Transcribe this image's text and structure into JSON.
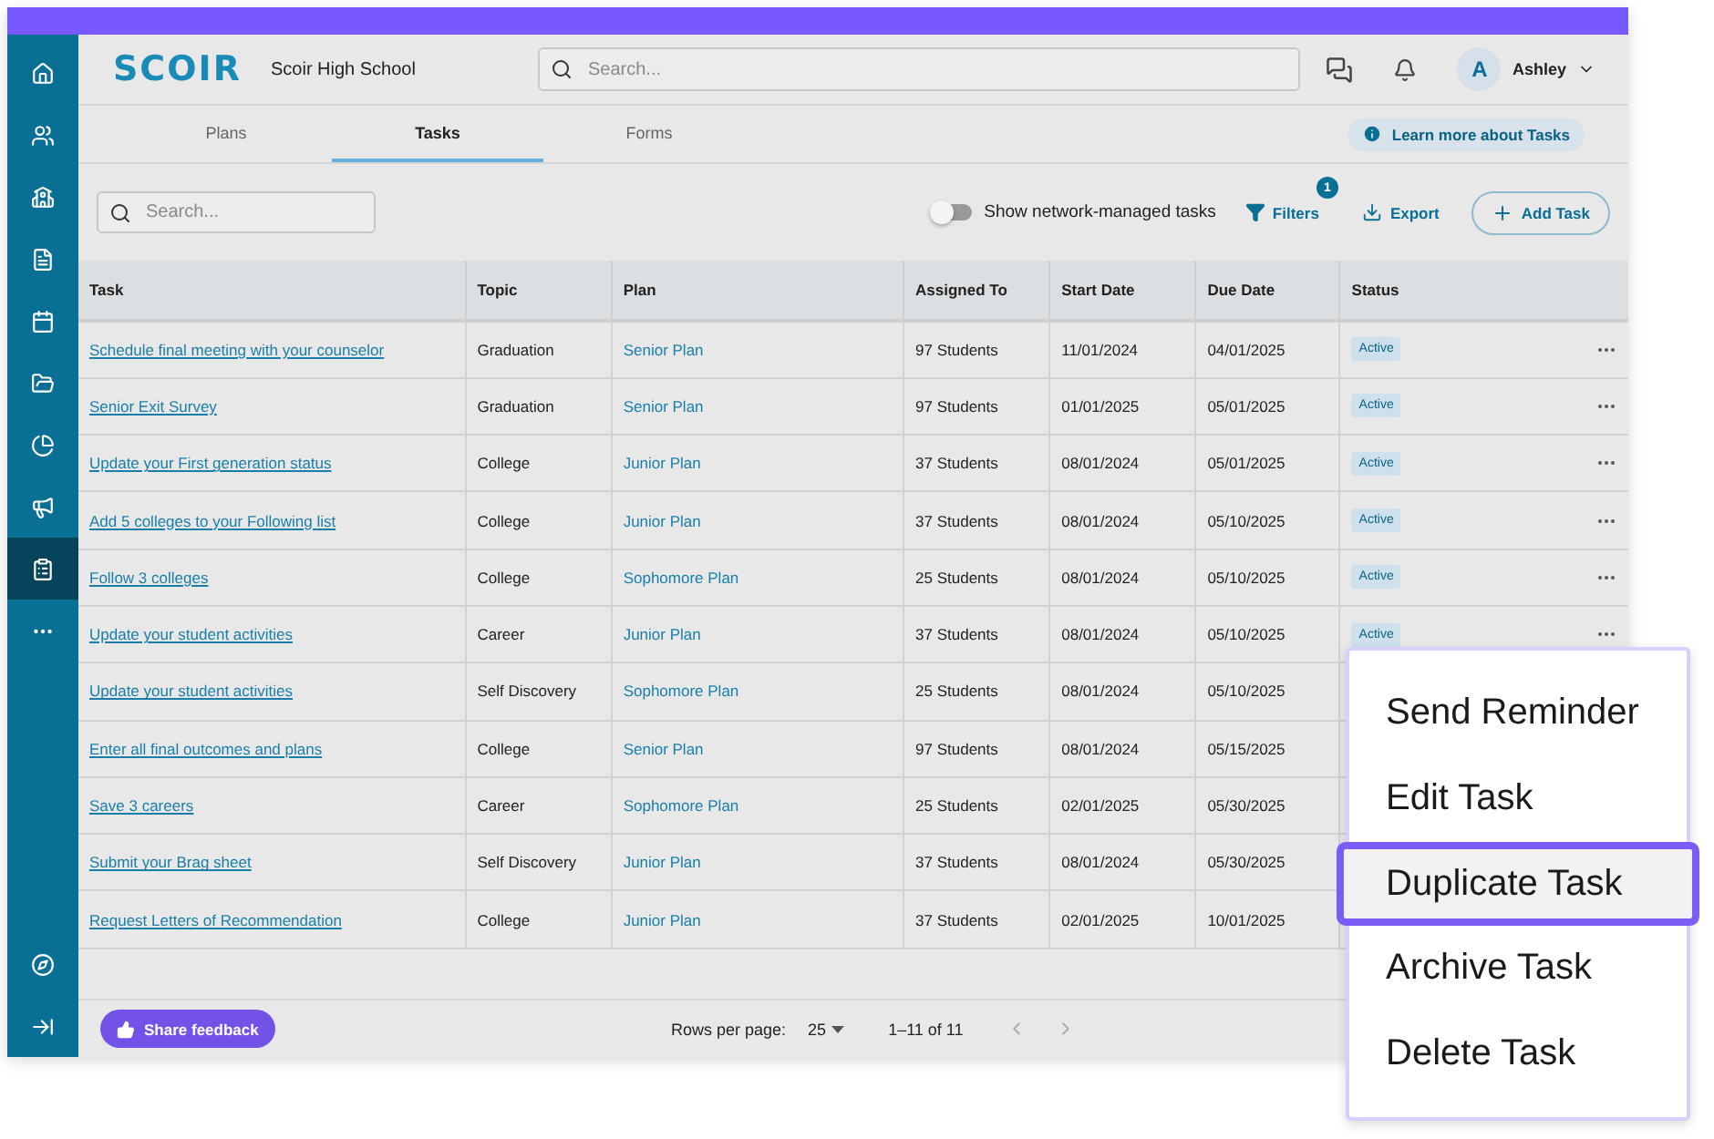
{
  "sidebar": {
    "items": [
      {
        "selected": false
      },
      {
        "selected": false
      },
      {
        "selected": false
      },
      {
        "selected": false
      },
      {
        "selected": false
      },
      {
        "selected": false
      },
      {
        "selected": false
      },
      {
        "selected": false
      },
      {
        "selected": true
      },
      {
        "selected": false
      }
    ]
  },
  "header": {
    "logo": "SCOIR",
    "school": "Scoir High School",
    "search": {
      "placeholder": "Search..."
    },
    "user": {
      "initial": "A",
      "name": "Ashley"
    }
  },
  "tabs": [
    {
      "label": "Plans",
      "selected": false
    },
    {
      "label": "Tasks",
      "selected": true
    },
    {
      "label": "Forms",
      "selected": false
    }
  ],
  "learn_more": "Learn more about Tasks",
  "toolbar": {
    "search": {
      "placeholder": "Search..."
    },
    "toggle": {
      "label": "Show network-managed tasks",
      "on": false
    },
    "filters": {
      "label": "Filters",
      "badge": "1"
    },
    "export": "Export",
    "add": "Add Task"
  },
  "table": {
    "columns": [
      "Task",
      "Topic",
      "Plan",
      "Assigned To",
      "Start Date",
      "Due Date",
      "Status"
    ],
    "rows": [
      {
        "task": "Schedule final meeting with your counselor",
        "topic": "Graduation",
        "plan": "Senior Plan",
        "assigned": "97 Students",
        "start": "11/01/2024",
        "due": "04/01/2025",
        "status": "Active"
      },
      {
        "task": "Senior Exit Survey",
        "topic": "Graduation",
        "plan": "Senior Plan",
        "assigned": "97 Students",
        "start": "01/01/2025",
        "due": "05/01/2025",
        "status": "Active"
      },
      {
        "task": "Update your First generation status",
        "topic": "College",
        "plan": "Junior Plan",
        "assigned": "37 Students",
        "start": "08/01/2024",
        "due": "05/01/2025",
        "status": "Active"
      },
      {
        "task": "Add 5 colleges to your Following list",
        "topic": "College",
        "plan": "Junior Plan",
        "assigned": "37 Students",
        "start": "08/01/2024",
        "due": "05/10/2025",
        "status": "Active"
      },
      {
        "task": "Follow 3 colleges",
        "topic": "College",
        "plan": "Sophomore Plan",
        "assigned": "25 Students",
        "start": "08/01/2024",
        "due": "05/10/2025",
        "status": "Active"
      },
      {
        "task": "Update your student activities",
        "topic": "Career",
        "plan": "Junior Plan",
        "assigned": "37 Students",
        "start": "08/01/2024",
        "due": "05/10/2025",
        "status": "Active"
      },
      {
        "task": "Update your student activities",
        "topic": "Self Discovery",
        "plan": "Sophomore Plan",
        "assigned": "25 Students",
        "start": "08/01/2024",
        "due": "05/10/2025"
      },
      {
        "task": "Enter all final outcomes and plans",
        "topic": "College",
        "plan": "Senior Plan",
        "assigned": "97 Students",
        "start": "08/01/2024",
        "due": "05/15/2025"
      },
      {
        "task": "Save 3 careers",
        "topic": "Career",
        "plan": "Sophomore Plan",
        "assigned": "25 Students",
        "start": "02/01/2025",
        "due": "05/30/2025"
      },
      {
        "task": "Submit your Brag sheet",
        "topic": "Self Discovery",
        "plan": "Junior Plan",
        "assigned": "37 Students",
        "start": "08/01/2024",
        "due": "05/30/2025"
      },
      {
        "task": "Request Letters of Recommendation",
        "topic": "College",
        "plan": "Junior Plan",
        "assigned": "37 Students",
        "start": "02/01/2025",
        "due": "10/01/2025"
      }
    ]
  },
  "footer": {
    "feedback": "Share feedback",
    "rows_per_page_label": "Rows per page:",
    "rows_per_page": "25",
    "range": "1–11 of 11"
  },
  "menu": [
    {
      "label": "Send Reminder",
      "selected": false
    },
    {
      "label": "Edit Task",
      "selected": false
    },
    {
      "label": "Duplicate Task",
      "selected": true
    },
    {
      "label": "Archive Task",
      "selected": false
    },
    {
      "label": "Delete Task",
      "selected": false
    }
  ]
}
